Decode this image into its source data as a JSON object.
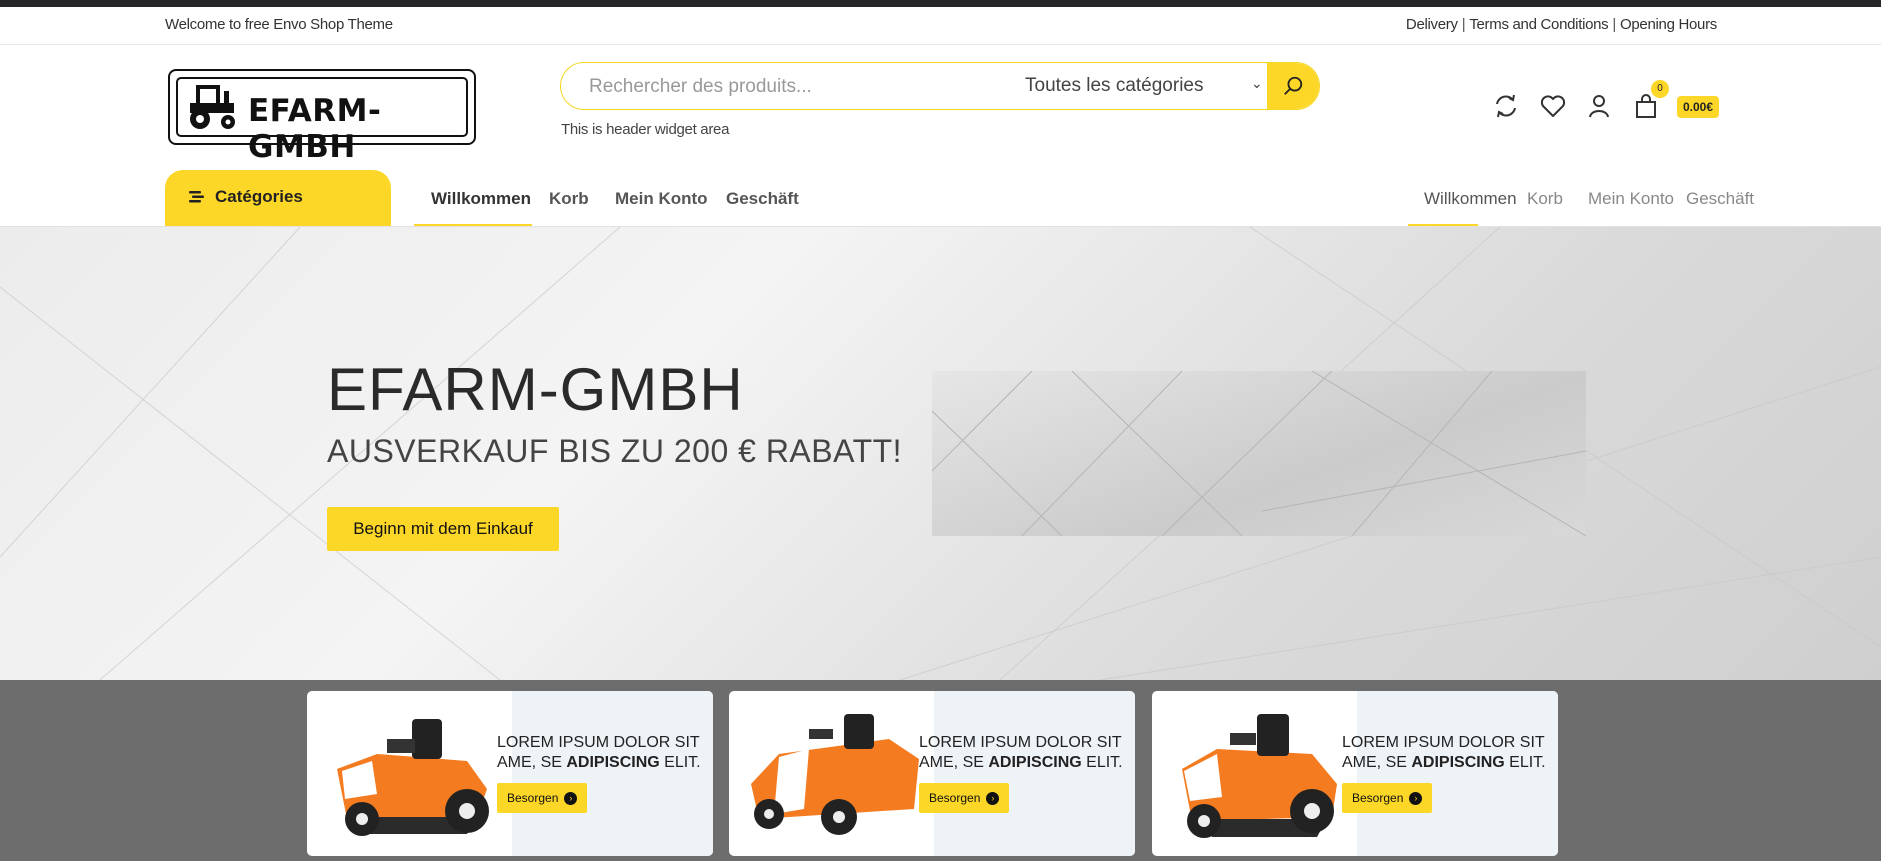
{
  "topbar": {
    "welcome": "Welcome to free Envo Shop Theme",
    "links": [
      "Delivery",
      "Terms and Conditions",
      "Opening Hours"
    ]
  },
  "logo": {
    "text": "EFARM-GMBH"
  },
  "search": {
    "placeholder": "Rechercher des produits...",
    "category": "Toutes les catégories"
  },
  "header_widget": "This is header widget area",
  "cart": {
    "count": "0",
    "price": "0.00€"
  },
  "categories_button": "Catégories",
  "main_nav": [
    "Willkommen",
    "Korb",
    "Mein Konto",
    "Geschäft"
  ],
  "right_nav": [
    "Willkommen",
    "Korb",
    "Mein Konto",
    "Geschäft"
  ],
  "hero": {
    "title": "EFARM-GMBH",
    "subtitle": "AUSVERKAUF BIS ZU 200 € RABATT!",
    "cta": "Beginn mit dem Einkauf"
  },
  "promos": [
    {
      "line1": "LOREM IPSUM DOLOR SIT",
      "line2_pre": "AME, SE ",
      "line2_bold": "ADIPISCING",
      "line2_post": " ELIT.",
      "button": "Besorgen"
    },
    {
      "line1": "LOREM IPSUM DOLOR SIT",
      "line2_pre": "AME, SE ",
      "line2_bold": "ADIPISCING",
      "line2_post": " ELIT.",
      "button": "Besorgen"
    },
    {
      "line1": "LOREM IPSUM DOLOR SIT",
      "line2_pre": "AME, SE ",
      "line2_bold": "ADIPISCING",
      "line2_post": " ELIT.",
      "button": "Besorgen"
    }
  ],
  "colors": {
    "accent": "#fcd728",
    "dark": "#26262b",
    "promo_bg": "#6d6d6d",
    "mower_orange": "#f47b1f"
  }
}
